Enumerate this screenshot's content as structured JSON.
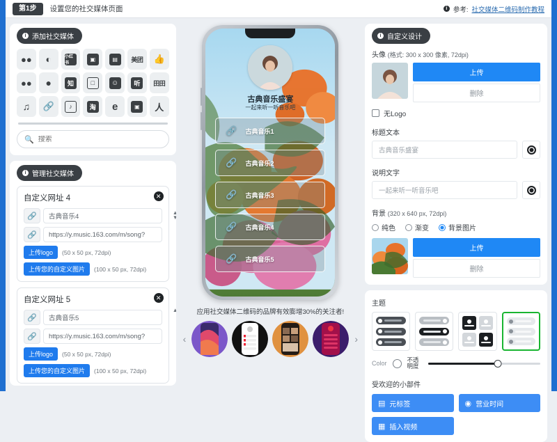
{
  "header": {
    "step_badge": "第1步",
    "title": "设置您的社交媒体页面",
    "info_icon": "info-icon",
    "reference_label": "参考:",
    "reference_link": "社交媒体二维码制作教程"
  },
  "left_panel": {
    "add_social": {
      "pill_label": "添加社交媒体",
      "icons": [
        {
          "name": "wechat-icon",
          "glyph": "●●"
        },
        {
          "name": "weibo-icon",
          "glyph": "◔"
        },
        {
          "name": "xiaohongshu-icon",
          "glyph": "小红书"
        },
        {
          "name": "bilibili-icon",
          "glyph": "▣"
        },
        {
          "name": "douyin-news-icon",
          "glyph": "▤"
        },
        {
          "name": "meituan-icon",
          "glyph": "美团"
        },
        {
          "name": "thumbs-up-icon",
          "glyph": "👍"
        },
        {
          "name": "wechat-moments-icon",
          "glyph": "●●"
        },
        {
          "name": "qq-icon",
          "glyph": "●"
        },
        {
          "name": "zhihu-icon",
          "glyph": "知"
        },
        {
          "name": "baidu-tieba-icon",
          "glyph": "□"
        },
        {
          "name": "smile-icon",
          "glyph": "☺"
        },
        {
          "name": "ximalaya-icon",
          "glyph": "听"
        },
        {
          "name": "tianyancha-icon",
          "glyph": "田田"
        },
        {
          "name": "netease-music-icon",
          "glyph": "♪"
        },
        {
          "name": "link-icon",
          "glyph": "🔗"
        },
        {
          "name": "tiktok-icon",
          "glyph": "♪"
        },
        {
          "name": "taobao-icon",
          "glyph": "淘"
        },
        {
          "name": "ele-icon",
          "glyph": "e"
        },
        {
          "name": "wechat-channel-icon",
          "glyph": "▣"
        },
        {
          "name": "keep-icon",
          "glyph": "人"
        }
      ],
      "search_placeholder": "搜索",
      "search_value": "",
      "search_icon": "search-icon"
    },
    "manage_social": {
      "pill_label": "管理社交媒体",
      "items": [
        {
          "title": "自定义网址 4",
          "name_value": "古典音乐4",
          "url_value": "https://y.music.163.com/m/song?",
          "logo_button": "上传logo",
          "logo_hint": "(50 x 50 px, 72dpi)",
          "image_button": "上传您的自定义图片",
          "image_hint": "(100 x 50 px, 72dpi)"
        },
        {
          "title": "自定义网址 5",
          "name_value": "古典音乐5",
          "url_value": "https://y.music.163.com/m/song?",
          "logo_button": "上传logo",
          "logo_hint": "(50 x 50 px, 72dpi)",
          "image_button": "上传您的自定义图片",
          "image_hint": "(100 x 50 px, 72dpi)"
        }
      ]
    }
  },
  "preview": {
    "profile_title": "古典音乐盛宴",
    "profile_subtitle": "一起来听一听音乐吧",
    "links": [
      {
        "label": "古典音乐1"
      },
      {
        "label": "古典音乐2"
      },
      {
        "label": "古典音乐3"
      },
      {
        "label": "古典音乐4"
      },
      {
        "label": "古典音乐5"
      }
    ],
    "promo_text": "应用社交媒体二维码的品牌有效膨增30%的关注者!",
    "carousel_prev": "‹",
    "carousel_next": "›",
    "thumbnails": [
      "theme-purple",
      "theme-white",
      "theme-orange",
      "theme-crimson"
    ]
  },
  "right_panel": {
    "custom_design": {
      "pill_label": "自定义设计",
      "avatar_label": "头像",
      "avatar_spec": "(格式: 300 x 300 像素, 72dpi)",
      "upload_label": "上传",
      "delete_label": "删除",
      "no_logo_label": "无Logo",
      "no_logo_checked": false,
      "title_text_label": "标题文本",
      "title_text_value": "古典音乐盛宴",
      "desc_text_label": "说明文字",
      "desc_text_value": "一起来听一听音乐吧",
      "background_label": "背景",
      "background_spec": "(320 x 640 px, 72dpi)",
      "background_options": [
        {
          "label": "纯色",
          "selected": false
        },
        {
          "label": "渐变",
          "selected": false
        },
        {
          "label": "背景图片",
          "selected": true
        }
      ],
      "bg_upload_label": "上传",
      "bg_delete_label": "删除"
    },
    "theme": {
      "title": "主题",
      "options": [
        {
          "name": "theme-dark-bars",
          "selected": false
        },
        {
          "name": "theme-gray-bars",
          "selected": false
        },
        {
          "name": "theme-grid-cards",
          "selected": false
        },
        {
          "name": "theme-light-bars",
          "selected": true
        }
      ],
      "color_label": "Color",
      "opacity_label": "不透明度",
      "opacity_value": 62
    },
    "widgets": {
      "title": "受欢迎的小部件",
      "items": [
        {
          "label": "元标签",
          "icon": "meta-tag-icon"
        },
        {
          "label": "营业时间",
          "icon": "clock-icon"
        },
        {
          "label": "插入视频",
          "icon": "video-icon"
        }
      ]
    }
  },
  "colors": {
    "accent_blue": "#1f88f5",
    "page_edge_blue": "#1f6fd0",
    "selected_green": "#19b531",
    "dark": "#3a3f44",
    "page_bg": "#eceff3"
  }
}
